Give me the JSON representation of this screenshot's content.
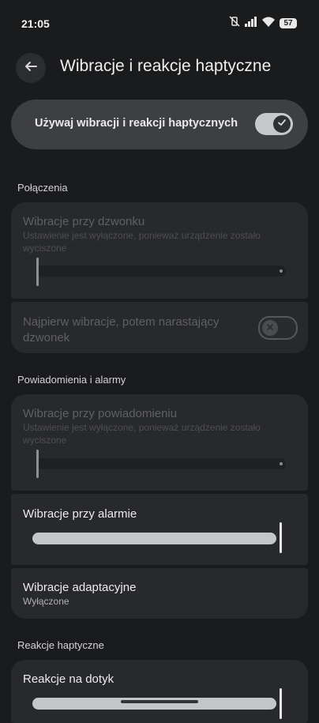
{
  "status_bar": {
    "time": "21:05",
    "battery": "57",
    "icons": [
      "vibrate-off-icon",
      "signal-icon",
      "wifi-icon",
      "battery-icon"
    ]
  },
  "header": {
    "title": "Wibracje i reakcje haptyczne",
    "back_icon": "arrow-back-icon"
  },
  "master_toggle": {
    "label": "Używaj wibracji i reakcji haptycznych",
    "enabled": true
  },
  "sections": {
    "calls": {
      "title": "Połączenia",
      "ring_vibration": {
        "title": "Wibracje przy dzwonku",
        "subtitle": "Ustawienie jest wyłączone, ponieważ urządzenie zostało wyciszone",
        "level": 0,
        "disabled": true
      },
      "ramp_ringer": {
        "title": "Najpierw wibracje, potem narastający dzwonek",
        "enabled": false,
        "disabled": true
      }
    },
    "notifications": {
      "title": "Powiadomienia i alarmy",
      "notification_vibration": {
        "title": "Wibracje przy powiadomieniu",
        "subtitle": "Ustawienie jest wyłączone, ponieważ urządzenie zostało wyciszone",
        "level": 0,
        "disabled": true
      },
      "alarm_vibration": {
        "title": "Wibracje przy alarmie",
        "level": 1
      },
      "adaptive_vibration": {
        "title": "Wibracje adaptacyjne",
        "value": "Wyłączone"
      }
    },
    "haptics": {
      "title": "Reakcje haptyczne",
      "touch_feedback": {
        "title": "Reakcje na dotyk",
        "level": 1
      }
    }
  },
  "colors": {
    "background": "#1a1b1d",
    "card": "#28292c",
    "master_card": "#3d3f43",
    "slider_fill": "#c4c6ca"
  }
}
